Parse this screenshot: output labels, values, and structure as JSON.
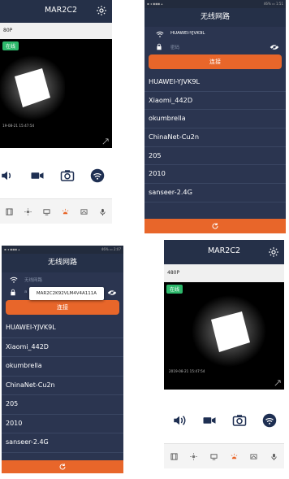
{
  "camera": {
    "title": "MAR2C2",
    "resolution": "480P",
    "resolution_cropped": "80P",
    "online": "在线",
    "timestamp": "2019-08-21  15:47:54",
    "timestamp_cropped": "19-08-21  15:47:54",
    "controls": [
      "speaker-icon",
      "video-record-icon",
      "camera-icon",
      "wifi-icon"
    ],
    "bottom_icons": [
      "film-icon",
      "light-icon",
      "monitor-icon",
      "alarm-icon",
      "image-icon",
      "mic-icon"
    ],
    "accent": "#e8662a"
  },
  "wifi": {
    "title": "无线网路",
    "ssid": "HUAWEI-YJVK9L",
    "password_placeholder": "密码",
    "ssid_dimmed": "无线网路",
    "connect_label": "连接",
    "networks": [
      "HUAWEI-YJVK9L",
      "Xiaomi_442D",
      "okumbrella",
      "ChinaNet-Cu2n",
      "205",
      "2010",
      "sanseer-2.4G"
    ],
    "popup_text": "MAR2C2K92VLM4V4A111A",
    "status_right": "46% ▭ 1:51",
    "status_right_2": "46% ▭ 2:07",
    "accent": "#e8662a",
    "bg": "#2b3550"
  }
}
